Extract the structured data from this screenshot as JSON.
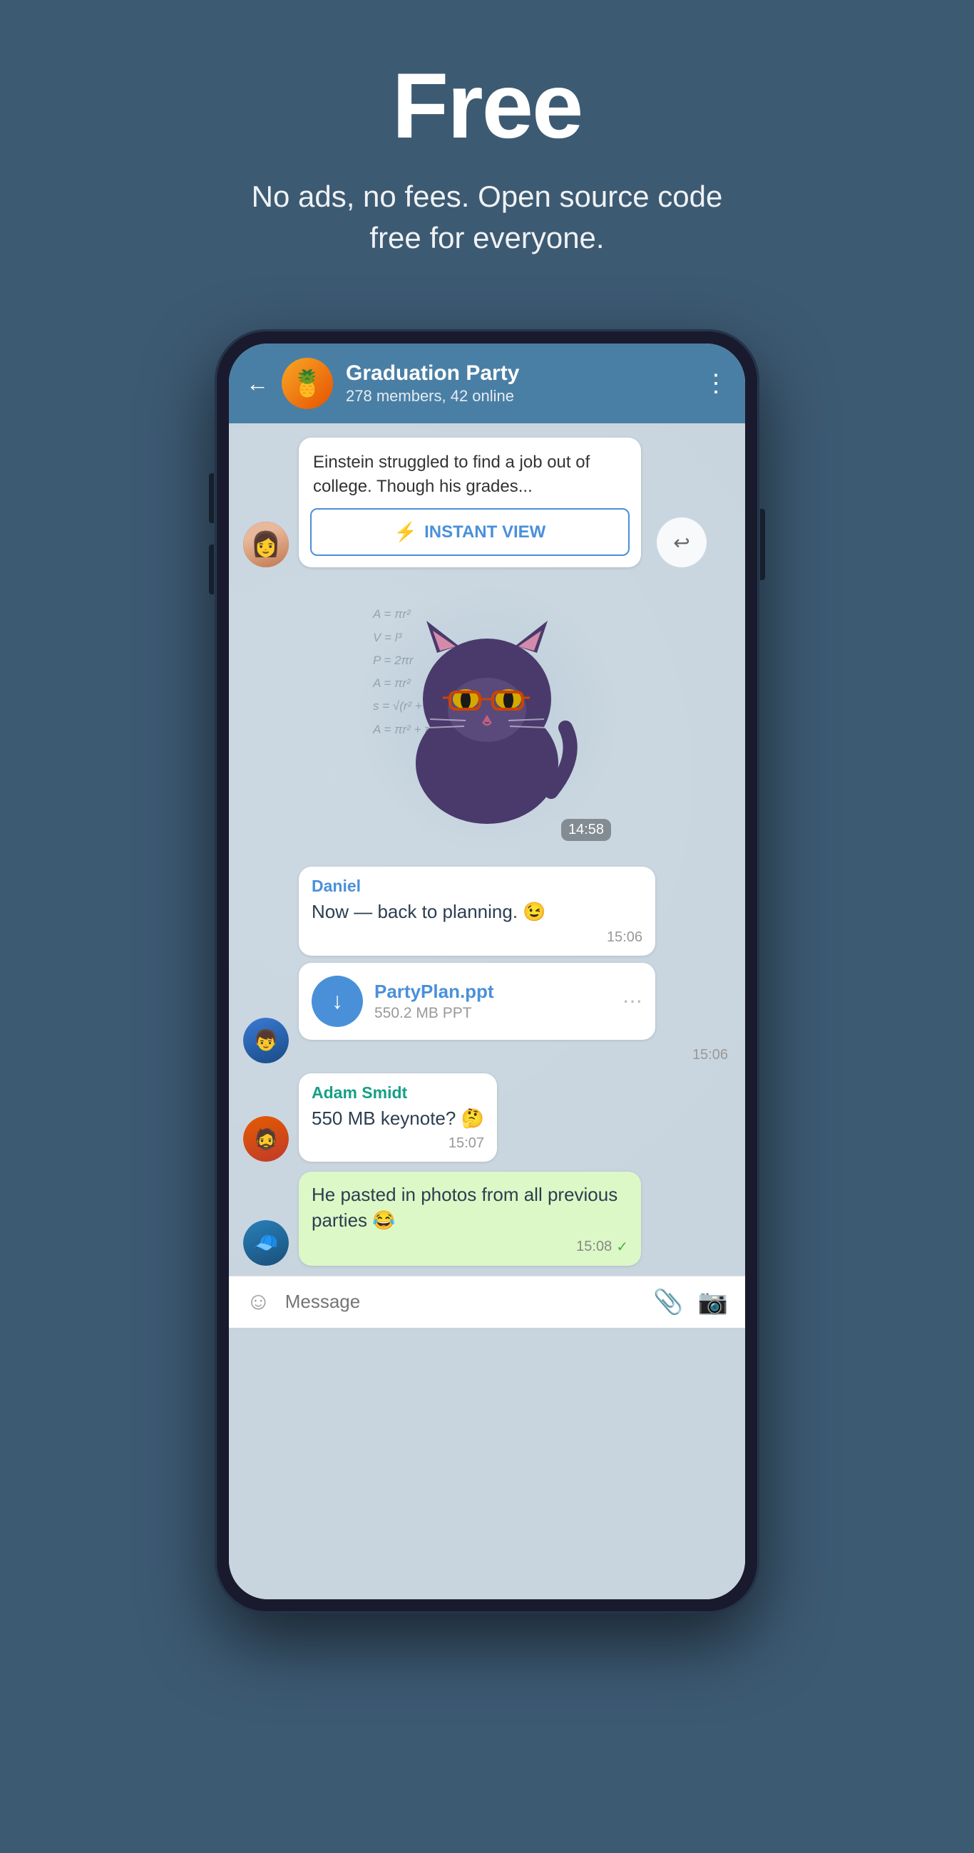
{
  "hero": {
    "title": "Free",
    "subtitle": "No ads, no fees. Open source code free for everyone."
  },
  "chat": {
    "back_label": "←",
    "group_name": "Graduation Party",
    "group_members": "278 members, 42 online",
    "more_icon": "⋮",
    "group_emoji": "🍍",
    "link_preview": {
      "text": "Einstein struggled to find a job out of college. Though his grades...",
      "instant_view_label": "INSTANT VIEW"
    },
    "sticker_time": "14:58",
    "messages": [
      {
        "sender": "Daniel",
        "sender_color": "blue",
        "text": "Now — back to planning. 😉",
        "time": "15:06"
      },
      {
        "type": "file",
        "filename": "PartyPlan.ppt",
        "filesize": "550.2 MB PPT",
        "time": "15:06"
      },
      {
        "sender": "Adam Smidt",
        "sender_color": "teal",
        "text": "550 MB keynote? 🤔",
        "time": "15:07"
      },
      {
        "type": "own",
        "text": "He pasted in photos from all previous parties 😂",
        "time": "15:08",
        "delivered": true
      }
    ],
    "input_placeholder": "Message"
  }
}
